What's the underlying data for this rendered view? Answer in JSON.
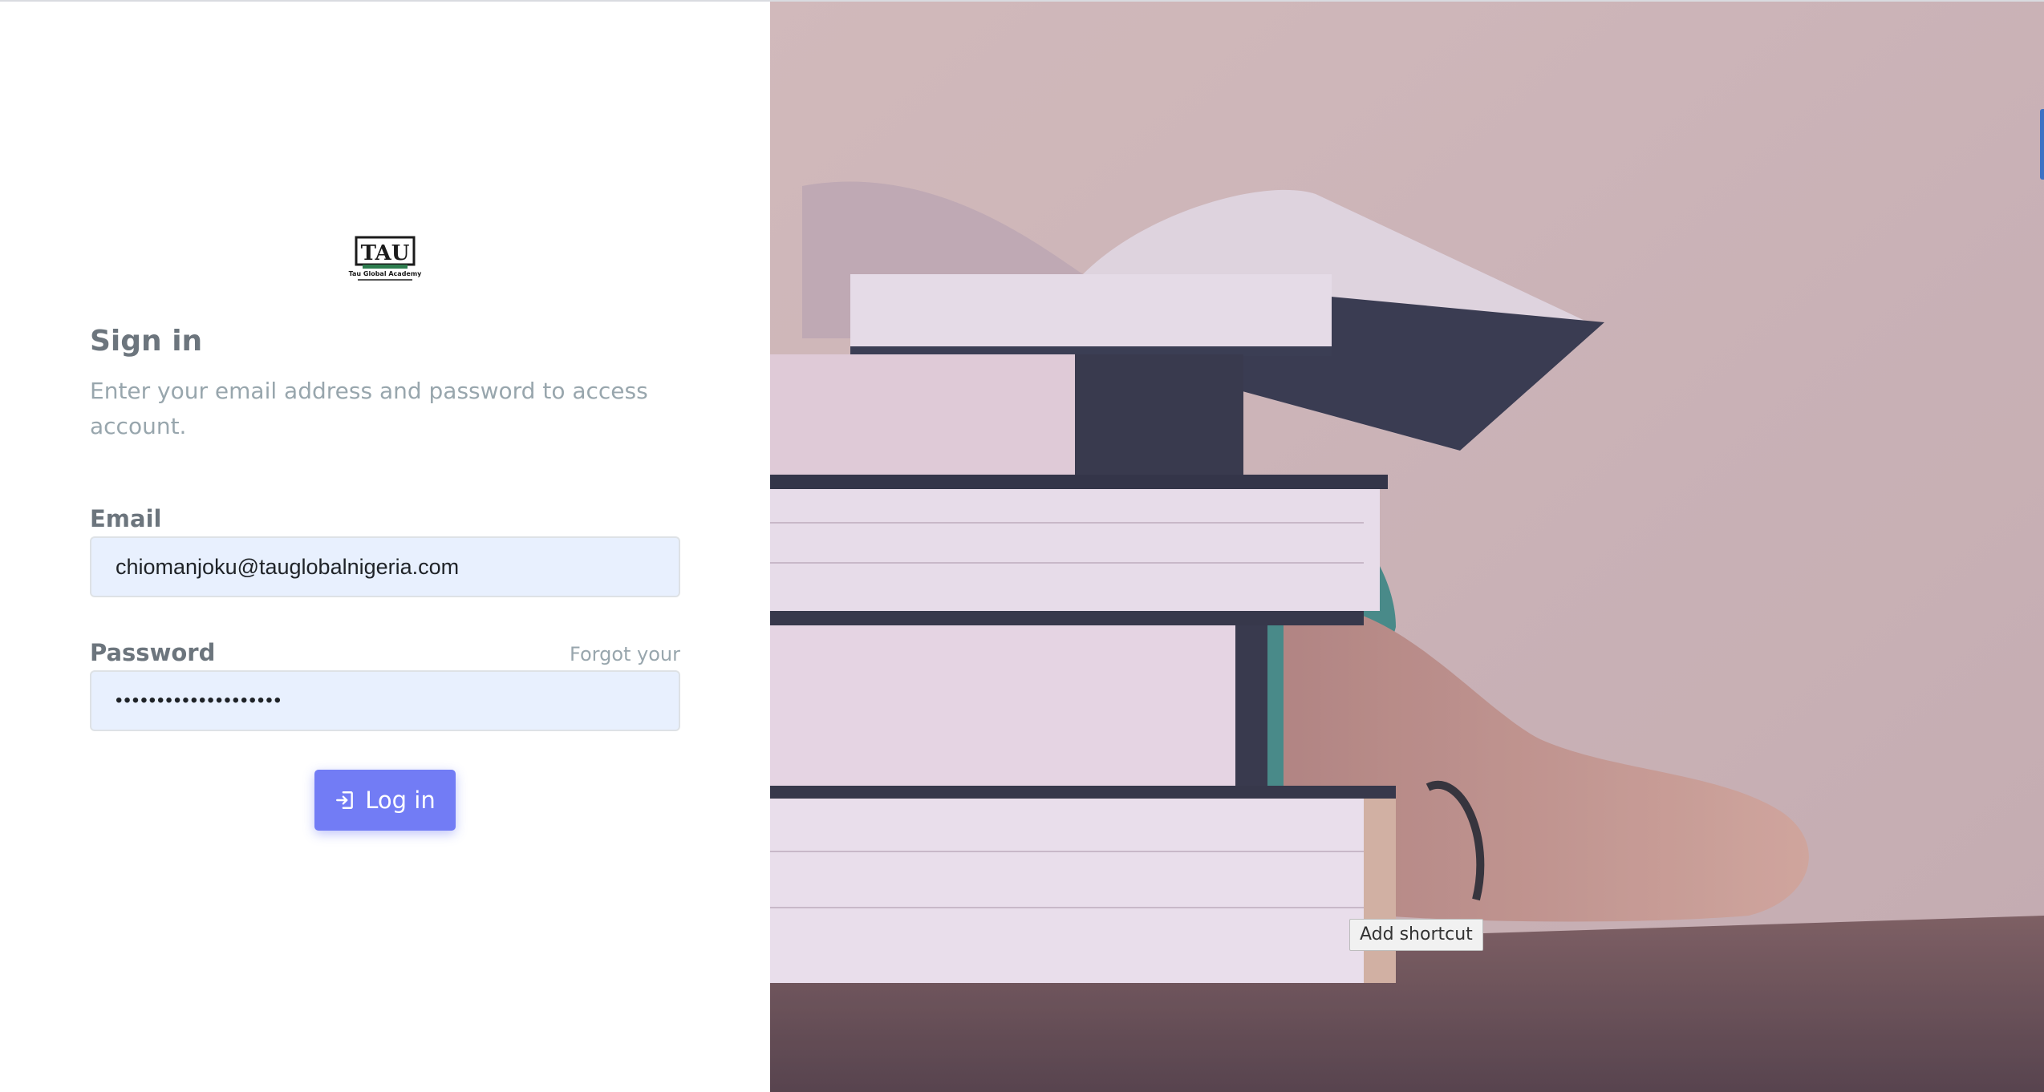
{
  "auth": {
    "logo_text": "TAU",
    "logo_caption": "Tau Global Academy",
    "title": "Sign in",
    "subtitle": "Enter your email address and password to access account.",
    "email_label": "Email",
    "email_value": "chiomanjoku@tauglobalnigeria.com",
    "password_label": "Password",
    "forgot_password": "Forgot your password?",
    "password_value": "••••••••••••••••••••",
    "login_label": "Log in"
  },
  "overlay": {
    "tooltip": "Add shortcut"
  },
  "colors": {
    "primary": "#727cf5",
    "input_bg": "#e8f0fe",
    "muted_text": "#98a6ad",
    "label_text": "#6c757d"
  },
  "icons": {
    "login": "login-icon",
    "logo": "tau-logo"
  }
}
